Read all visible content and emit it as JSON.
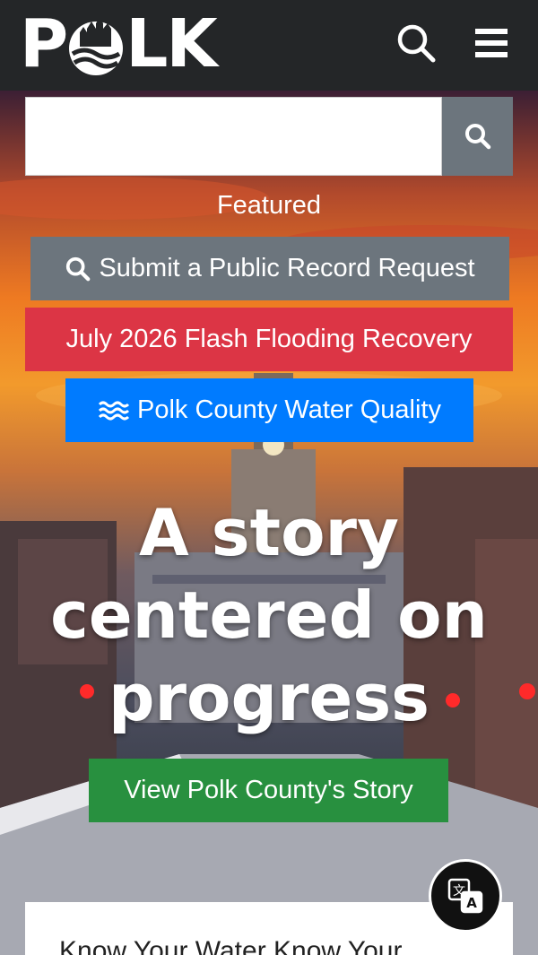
{
  "header": {
    "logo_text_left": "P",
    "logo_text_right": "LK",
    "search_icon": "search-icon",
    "menu_icon": "hamburger-menu-icon"
  },
  "search": {
    "value": "",
    "placeholder": "",
    "button_icon": "search-icon"
  },
  "featured": {
    "label": "Featured",
    "buttons": [
      {
        "label": "Submit a Public Record Request",
        "icon": "search-icon",
        "color": "#6c757d"
      },
      {
        "label": "July 2026 Flash Flooding Recovery",
        "color": "#dc3545"
      },
      {
        "label": "Polk County Water Quality",
        "icon": "water-waves-icon",
        "color": "#007bff"
      }
    ]
  },
  "hero": {
    "headline": "A story centered on progress",
    "cta_label": "View Polk County's Story",
    "cta_color": "#28903f"
  },
  "translate": {
    "icon": "translate-icon"
  },
  "card": {
    "title": "Know Your Water Know Your"
  }
}
